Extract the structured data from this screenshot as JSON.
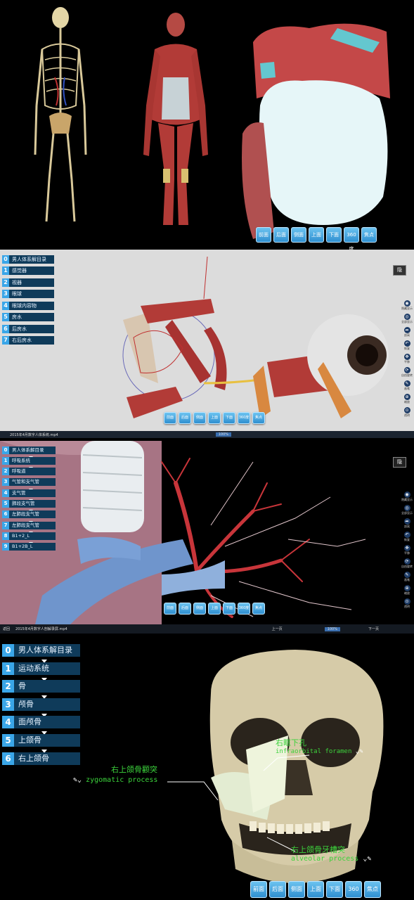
{
  "panel1": {
    "view_buttons": [
      "前面",
      "后面",
      "侧面",
      "上面",
      "下面",
      "360度",
      "焦点"
    ]
  },
  "panel2": {
    "breadcrumbs": [
      {
        "num": "0",
        "label": "男人体系解目录"
      },
      {
        "num": "1",
        "label": "感觉器"
      },
      {
        "num": "2",
        "label": "视器"
      },
      {
        "num": "3",
        "label": "眼球"
      },
      {
        "num": "4",
        "label": "眼球内容物"
      },
      {
        "num": "5",
        "label": "房水"
      },
      {
        "num": "6",
        "label": "后房水"
      },
      {
        "num": "7",
        "label": "右后房水"
      }
    ],
    "corner_toggle": "隐",
    "side_tools": [
      {
        "icon": "eye-icon",
        "label": "隐藏显示"
      },
      {
        "icon": "show-all-icon",
        "label": "全部显示"
      },
      {
        "icon": "share-icon",
        "label": "剖离"
      },
      {
        "icon": "undo-icon",
        "label": "恢复"
      },
      {
        "icon": "pan-icon",
        "label": "平移"
      },
      {
        "icon": "rotate-icon",
        "label": "自由旋转"
      },
      {
        "icon": "pen-icon",
        "label": "画笔"
      },
      {
        "icon": "zoom-icon",
        "label": "缩放"
      },
      {
        "icon": "focus-icon",
        "label": "透明"
      }
    ],
    "view_buttons": [
      "前面",
      "后面",
      "侧面",
      "上面",
      "下面",
      "360度",
      "焦点"
    ]
  },
  "panel3": {
    "topbar": {
      "title": "2015年4月数字人体系统.mp4",
      "tab": "100%"
    },
    "breadcrumbs": [
      {
        "num": "0",
        "label": "男人体系解目录"
      },
      {
        "num": "1",
        "label": "呼吸系统"
      },
      {
        "num": "2",
        "label": "呼吸道"
      },
      {
        "num": "3",
        "label": "气管和支气管"
      },
      {
        "num": "4",
        "label": "支气管"
      },
      {
        "num": "5",
        "label": "肺段支气管"
      },
      {
        "num": "6",
        "label": "左肺段支气管"
      },
      {
        "num": "7",
        "label": "左肺段支气管"
      },
      {
        "num": "8",
        "label": "B1+2_L"
      },
      {
        "num": "9",
        "label": "B1+2B_L"
      }
    ],
    "corner_toggle": "隐",
    "view_buttons": [
      "前面",
      "后面",
      "侧面",
      "上面",
      "下面",
      "360度",
      "焦点"
    ]
  },
  "panel4": {
    "topbar": {
      "back": "返回",
      "title": "2015年4月数字人剖解录屏.mp4",
      "prev": "上一页",
      "zoom": "100%",
      "next": "下一页"
    },
    "breadcrumbs": [
      {
        "num": "0",
        "label": "男人体系解目录"
      },
      {
        "num": "1",
        "label": "运动系统"
      },
      {
        "num": "2",
        "label": "骨"
      },
      {
        "num": "3",
        "label": "颅骨"
      },
      {
        "num": "4",
        "label": "面颅骨"
      },
      {
        "num": "5",
        "label": "上颌骨"
      },
      {
        "num": "6",
        "label": "右上颌骨"
      }
    ],
    "annotations": {
      "zygomatic_cn": "右上颌骨颧突",
      "zygomatic_en": "zygomatic process",
      "infraorbital_cn": "右眶下孔",
      "infraorbital_en": "infraorbital foramen",
      "alveolar_cn": "右上颌骨牙槽突",
      "alveolar_en": "alveolar process"
    },
    "view_buttons": [
      "前面",
      "后面",
      "侧面",
      "上面",
      "下面",
      "360度",
      "焦点"
    ]
  }
}
